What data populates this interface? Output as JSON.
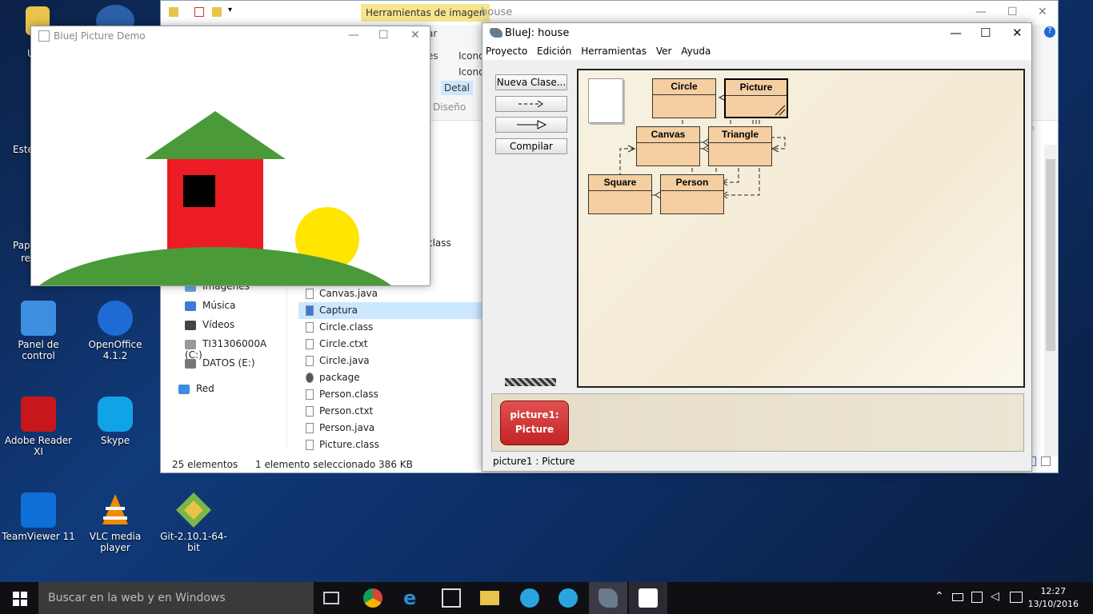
{
  "desktop": {
    "icons": [
      {
        "label": "Panel de control",
        "color": "#3c8ee0"
      },
      {
        "label": "OpenOffice 4.1.2",
        "color": "#1e6bd6"
      },
      {
        "label": "Adobe Reader XI",
        "color": "#c8171b"
      },
      {
        "label": "Skype",
        "color": "#10a3e6"
      },
      {
        "label": "TeamViewer 11",
        "color": "#0e6fd6"
      },
      {
        "label": "VLC media player",
        "color": "#f08a00"
      },
      {
        "label": "Git-2.10.1-64-bit",
        "color": "#7ab648"
      }
    ],
    "partial_labels": {
      "ester": "Este",
      "papel1": "Pap",
      "papel2": "re",
      "u": "U"
    }
  },
  "explorer": {
    "tools_tab": "Herramientas de imagen",
    "title": "house",
    "ribbon": {
      "iconos1": "Icono",
      "iconos2": "Icono",
      "detalles": "Detal",
      "diseno": "Diseño",
      "es": "es",
      "ar": "ar",
      "class_partial": "class",
      "s_partial": "s"
    },
    "nav_items": [
      {
        "label": "Imágenes"
      },
      {
        "label": "Música"
      },
      {
        "label": "Vídeos"
      },
      {
        "label": "TI31306000A (C:)"
      },
      {
        "label": "DATOS (E:)"
      },
      {
        "label": "Red"
      }
    ],
    "files": [
      "Canvas.java",
      "Captura",
      "Circle.class",
      "Circle.ctxt",
      "Circle.java",
      "package",
      "Person.class",
      "Person.ctxt",
      "Person.java",
      "Picture.class"
    ],
    "selected_file": "Captura",
    "status": {
      "count": "25 elementos",
      "selection": "1 elemento seleccionado  386 KB"
    }
  },
  "demo": {
    "title": "BlueJ Picture Demo",
    "colors": {
      "roof": "#4a9a3a",
      "wall": "#ed1c24",
      "window": "#000000",
      "sun": "#ffe500",
      "hill": "#4a9a3a"
    }
  },
  "bluej": {
    "title": "BlueJ:  house",
    "menu": [
      "Proyecto",
      "Edición",
      "Herramientas",
      "Ver",
      "Ayuda"
    ],
    "buttons": {
      "new_class": "Nueva Clase...",
      "compile": "Compilar"
    },
    "classes": {
      "circle": "Circle",
      "picture": "Picture",
      "canvas": "Canvas",
      "triangle": "Triangle",
      "square": "Square",
      "person": "Person"
    },
    "object": {
      "line1": "picture1:",
      "line2": "Picture"
    },
    "status": "picture1 : Picture"
  },
  "taskbar": {
    "search_placeholder": "Buscar en la web y en Windows",
    "time": "12:27",
    "date": "13/10/2016"
  }
}
